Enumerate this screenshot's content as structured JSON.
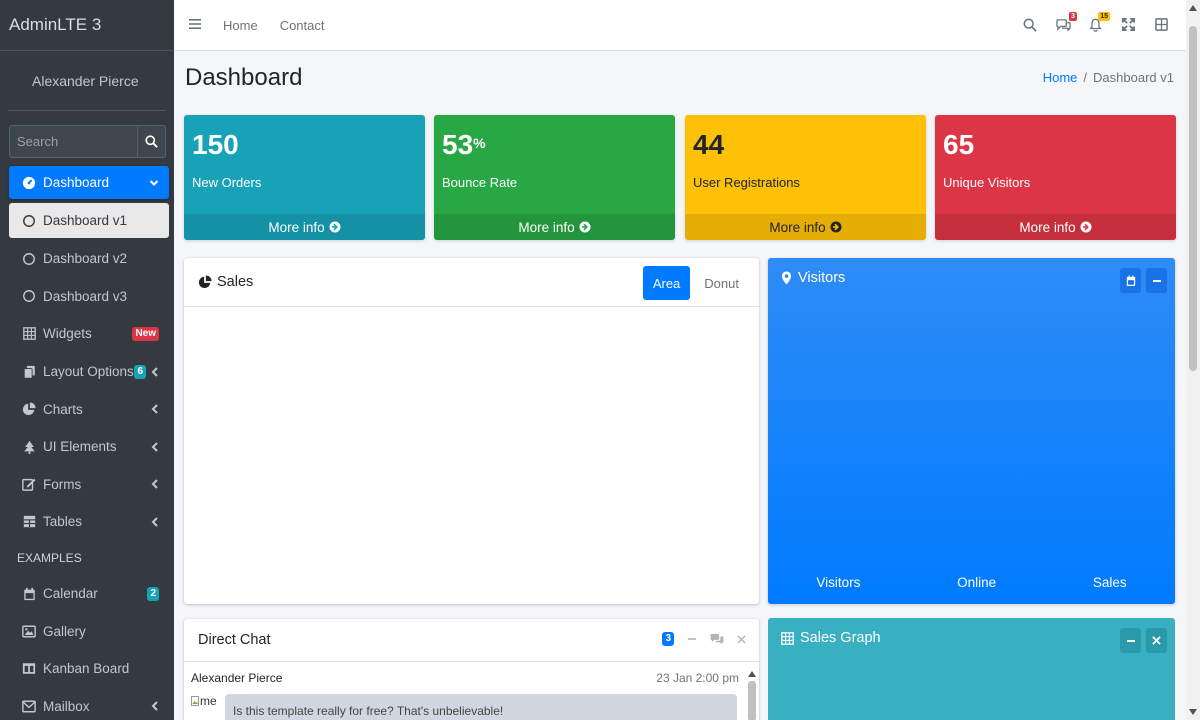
{
  "brand": "AdminLTE 3",
  "user": "Alexander Pierce",
  "sidebar": {
    "search_placeholder": "Search",
    "items": [
      {
        "label": "Dashboard"
      },
      {
        "label": "Dashboard v1"
      },
      {
        "label": "Dashboard v2"
      },
      {
        "label": "Dashboard v3"
      },
      {
        "label": "Widgets",
        "badge": "New"
      },
      {
        "label": "Layout Options",
        "badge": "6"
      },
      {
        "label": "Charts"
      },
      {
        "label": "UI Elements"
      },
      {
        "label": "Forms"
      },
      {
        "label": "Tables"
      },
      {
        "label": "Calendar",
        "badge": "2"
      },
      {
        "label": "Gallery"
      },
      {
        "label": "Kanban Board"
      },
      {
        "label": "Mailbox"
      }
    ],
    "section_header": "EXAMPLES"
  },
  "topbar": {
    "links": [
      "Home",
      "Contact"
    ],
    "messages_badge": "3",
    "notifications_badge": "15"
  },
  "content": {
    "title": "Dashboard",
    "breadcrumb": {
      "home": "Home",
      "separator": "/",
      "current": "Dashboard v1"
    }
  },
  "stats": [
    {
      "value": "150",
      "suffix": "",
      "label": "New Orders",
      "footer": "More info",
      "color": "#17a2b8"
    },
    {
      "value": "53",
      "suffix": "%",
      "label": "Bounce Rate",
      "footer": "More info",
      "color": "#28a745"
    },
    {
      "value": "44",
      "suffix": "",
      "label": "User Registrations",
      "footer": "More info",
      "color": "#ffc107"
    },
    {
      "value": "65",
      "suffix": "",
      "label": "Unique Visitors",
      "footer": "More info",
      "color": "#dc3545"
    }
  ],
  "sales": {
    "title": "Sales",
    "tabs": [
      "Area",
      "Donut"
    ],
    "active_tab": "Area"
  },
  "visitors": {
    "title": "Visitors",
    "labels": [
      "Visitors",
      "Online",
      "Sales"
    ]
  },
  "sales_graph": {
    "title": "Sales Graph"
  },
  "chat": {
    "title": "Direct Chat",
    "badge": "3",
    "message": {
      "name": "Alexander Pierce",
      "time": "23 Jan 2:00 pm",
      "avatar_alt": "me",
      "text": "Is this template really for free? That's unbelievable!"
    }
  },
  "colors": {
    "primary": "#007bff",
    "sidebar": "#343a40",
    "info": "#17a2b8",
    "success": "#28a745",
    "warning": "#ffc107",
    "danger": "#dc3545"
  }
}
